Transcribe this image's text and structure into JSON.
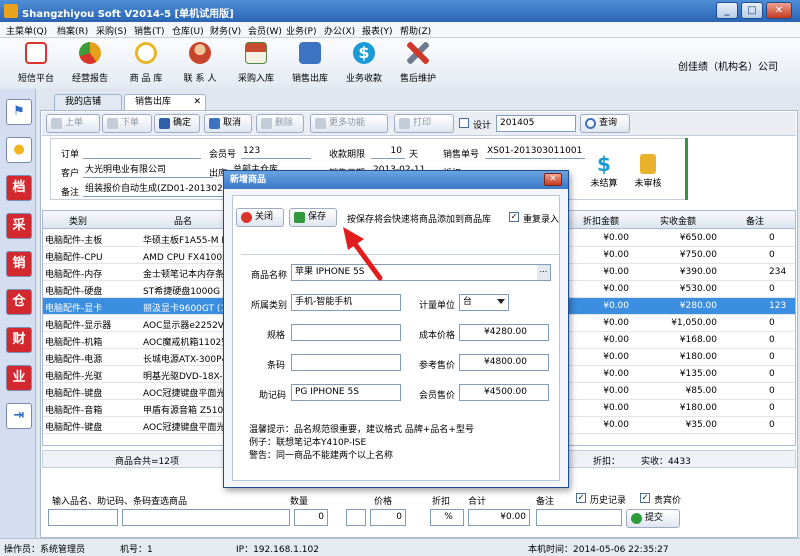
{
  "window": {
    "title": "Shangzhiyou Soft V2014-5 [单机试用版]",
    "min": "_",
    "max": "□",
    "close": "✕"
  },
  "menu": [
    "主菜单(Q)",
    "档案(R)",
    "采购(S)",
    "销售(T)",
    "仓库(U)",
    "财务(V)",
    "会员(W)",
    "业务(P)",
    "办公(X)",
    "报表(Y)",
    "帮助(Z)"
  ],
  "toolbar": {
    "items": [
      {
        "label": "短信平台",
        "icon": "envelope-icon",
        "color": "#d8342b"
      },
      {
        "label": "经营报告",
        "icon": "pie-chart-icon",
        "color": "#e5a01b"
      },
      {
        "label": "商 品 库",
        "icon": "magnifier-icon",
        "color": "#e8b62a"
      },
      {
        "label": "联 系 人",
        "icon": "person-icon",
        "color": "#c8452d"
      },
      {
        "label": "采购入库",
        "icon": "house-icon",
        "color": "#4d8a3f"
      },
      {
        "label": "销售出库",
        "icon": "cart-icon",
        "color": "#3d74c2"
      },
      {
        "label": "业务收款",
        "icon": "dollar-icon",
        "color": "#1b9bd6"
      },
      {
        "label": "售后维护",
        "icon": "tools-icon",
        "color": "#d0392a"
      }
    ],
    "company": "创佳绩（机构名）公司"
  },
  "leftbar": [
    {
      "glyph": "⚑",
      "icon": "flag-icon",
      "color": "#2f6bc6"
    },
    {
      "glyph": "●",
      "icon": "lightbulb-icon",
      "color": "#f2b51d"
    },
    {
      "glyph": "档",
      "icon": "archive-icon",
      "color": "#d2282e"
    },
    {
      "glyph": "采",
      "icon": "purchase-icon",
      "color": "#d2282e"
    },
    {
      "glyph": "销",
      "icon": "sales-icon",
      "color": "#d2282e"
    },
    {
      "glyph": "仓",
      "icon": "warehouse-icon",
      "color": "#d2282e"
    },
    {
      "glyph": "财",
      "icon": "finance-icon",
      "color": "#d2282e"
    },
    {
      "glyph": "业",
      "icon": "business-icon",
      "color": "#d2282e"
    },
    {
      "glyph": "⇥",
      "icon": "exit-icon",
      "color": "#2f6bc6"
    }
  ],
  "tabs": [
    {
      "label": "我的店铺"
    },
    {
      "label": "销售出库",
      "close": "✕"
    }
  ],
  "actions": {
    "up": "上单",
    "down": "下单",
    "confirm": "确定",
    "cancel": "取消",
    "delete": "删除",
    "more": "更多功能",
    "print": "打印",
    "design": "设计",
    "period": "201405",
    "query": "查询"
  },
  "header": {
    "order_label": "订单",
    "customer_label": "客户",
    "customer_value": "大光明电业有限公司",
    "remark_label": "备注",
    "remark_value": "组装报价自动生成(ZD01-20130211",
    "member_label": "会员号",
    "member_value": "123",
    "out_label": "出库",
    "out_value": "总部主仓库",
    "term_label": "收款期限",
    "term_value": "10",
    "term_unit": "天",
    "date_label": "销售日期",
    "date_value": "2013-02-11",
    "no_label": "销售单号",
    "no_value": "XS01-201303011001",
    "discount_label": "折扣",
    "unsettled": "未结算",
    "unreviewed": "未审核"
  },
  "grid": {
    "columns": [
      "类别",
      "品名",
      "折扣金额",
      "实收金额",
      "备注"
    ],
    "rows": [
      {
        "cat": "电脑配件-主板",
        "name": "华硕主板F1A55-M LX3",
        "disc": "¥0.00",
        "actual": "¥650.00",
        "note": "0"
      },
      {
        "cat": "电脑配件-CPU",
        "name": "AMD CPU FX4100四核/3.",
        "disc": "¥0.00",
        "actual": "¥750.00",
        "note": "0"
      },
      {
        "cat": "电脑配件-内存",
        "name": "金士顿笔记本内存条DDR2/",
        "disc": "¥0.00",
        "actual": "¥390.00",
        "note": "234"
      },
      {
        "cat": "电脑配件-硬盘",
        "name": "ST希捷硬盘1000G SATA (",
        "disc": "¥0.00",
        "actual": "¥530.00",
        "note": "0"
      },
      {
        "cat": "电脑配件-显卡",
        "name": "丽汲显卡9600GT (1G) 蓝",
        "disc": "¥0.00",
        "actual": "¥280.00",
        "note": "123",
        "selected": true
      },
      {
        "cat": "电脑配件-显示器",
        "name": "AOC显示器e2252V(22寸)L",
        "disc": "¥0.00",
        "actual": "¥1,050.00",
        "note": "0"
      },
      {
        "cat": "电脑配件-机箱",
        "name": "AOC魔戒机箱1102空机箱",
        "disc": "¥0.00",
        "actual": "¥168.00",
        "note": "0"
      },
      {
        "cat": "电脑配件-电源",
        "name": "长城电源ATX-300P4-PFC",
        "disc": "¥0.00",
        "actual": "¥180.00",
        "note": "0"
      },
      {
        "cat": "电脑配件-光驱",
        "name": "明基光驱DVD-18X-SATA-",
        "disc": "¥0.00",
        "actual": "¥135.00",
        "note": "0"
      },
      {
        "cat": "电脑配件-键盘",
        "name": "AOC冠捷键盘平面光电A22",
        "disc": "¥0.00",
        "actual": "¥85.00",
        "note": "0"
      },
      {
        "cat": "电脑配件-音箱",
        "name": "甲盾有源音箱 Z510",
        "disc": "¥0.00",
        "actual": "¥180.00",
        "note": "0"
      },
      {
        "cat": "电脑配件-键盘",
        "name": "AOC冠捷键盘平面光电A22",
        "disc": "¥0.00",
        "actual": "¥35.00",
        "note": "0"
      }
    ],
    "summary": {
      "count": "商品合共=12项",
      "discount": "折扣：",
      "actual": "实收：4433"
    }
  },
  "entry": {
    "search_label": "输入品名、助记码、条码查选商品",
    "qty_label": "数量",
    "qty_value": "0",
    "price_label": "价格",
    "price_value": "0",
    "disc_label": "折扣",
    "disc_unit": "%",
    "total_label": "合计",
    "total_value": "¥0.00",
    "note_label": "备注",
    "history": "历史记录",
    "vip": "贵宾价",
    "submit": "提交"
  },
  "status": {
    "operator": "操作员：系统管理员",
    "machine": "机号：1",
    "ip": "IP：192.168.1.102",
    "time": "本机时间：2014-05-06 22:35:27"
  },
  "dialog": {
    "title": "新增商品",
    "close_x": "✕",
    "close": "关闭",
    "save": "保存",
    "hint": "按保存将会快速将商品添加到商品库",
    "repeat": "重复录入",
    "name_label": "商品名称",
    "name_value": "苹果 IPHONE 5S",
    "cat_label": "所属类别",
    "cat_value": "手机-智能手机",
    "unit_label": "计量单位",
    "unit_value": "台",
    "spec_label": "规格",
    "spec_value": "",
    "cost_label": "成本价格",
    "cost_value": "¥4280.00",
    "barcode_label": "条码",
    "barcode_value": "",
    "ref_label": "参考售价",
    "ref_value": "¥4800.00",
    "mnemonic_label": "助记码",
    "mnemonic_value": "PG IPHONE 5S",
    "member_label": "会员售价",
    "member_value": "¥4500.00",
    "tip1": "温馨提示：品名规范很重要，建议格式  品牌+品名+型号",
    "tip2": "例子：联想笔记本Y410P-ISE",
    "tip3": "警告：同一商品不能建两个以上名称"
  }
}
